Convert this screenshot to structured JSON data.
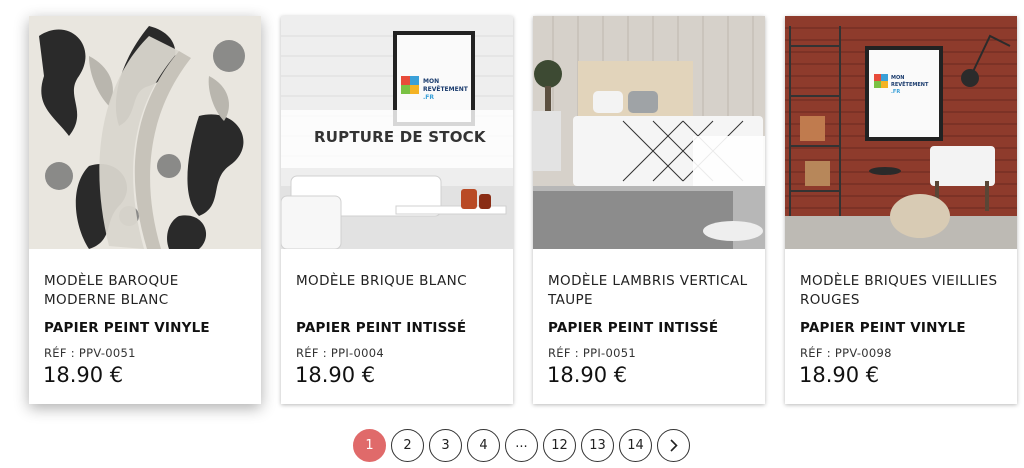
{
  "products": [
    {
      "name": "Modèle baroque moderne blanc",
      "type": "PAPIER PEINT VINYLE",
      "ref": "RÉF : PPV-0051",
      "price": "18.90 €"
    },
    {
      "name": "Modèle brique blanc",
      "type": "PAPIER PEINT INTISSÉ",
      "ref": "RÉF : PPI-0004",
      "price": "18.90 €",
      "badge": "RUPTURE DE STOCK",
      "poster_logo": "MON REVÊTEMENT .FR"
    },
    {
      "name": "Modèle lambris vertical taupe",
      "type": "PAPIER PEINT INTISSÉ",
      "ref": "RÉF : PPI-0051",
      "price": "18.90 €"
    },
    {
      "name": "Modèle briques vieillies rouges",
      "type": "PAPIER PEINT VINYLE",
      "ref": "RÉF : PPV-0098",
      "price": "18.90 €",
      "poster_logo": "MON REVÊTEMENT .FR"
    }
  ],
  "pagination": {
    "pages": [
      "1",
      "2",
      "3",
      "4",
      "...",
      "12",
      "13",
      "14"
    ],
    "current": "1",
    "next_icon": "chevron-right-icon"
  },
  "colors": {
    "accent": "#e06a6a",
    "brick": "#8e3b2c"
  }
}
